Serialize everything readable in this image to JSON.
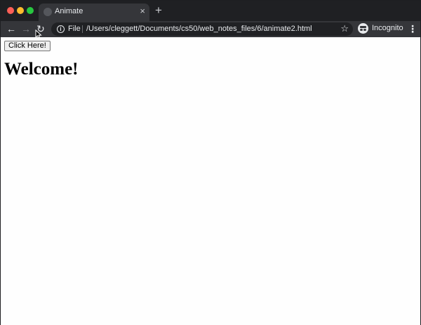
{
  "browser": {
    "tab": {
      "title": "Animate",
      "close_glyph": "×"
    },
    "new_tab_glyph": "+",
    "nav": {
      "back_glyph": "←",
      "forward_glyph": "→",
      "reload_glyph": "↻"
    },
    "omnibox": {
      "scheme": "File",
      "url": "/Users/cleggett/Documents/cs50/web_notes_files/6/animate2.html",
      "star_glyph": "☆"
    },
    "profile": {
      "label": "Incognito"
    },
    "menu_glyph": "⋮"
  },
  "page": {
    "button_label": "Click Here!",
    "heading": "Welcome!"
  },
  "icons": {
    "close": "close-icon",
    "new_tab": "plus-icon",
    "back": "back-arrow-icon",
    "forward": "forward-arrow-icon",
    "reload": "reload-icon",
    "info": "info-icon",
    "star": "star-icon",
    "incognito": "incognito-icon",
    "menu": "kebab-menu-icon",
    "cursor": "mouse-cursor-icon"
  },
  "colors": {
    "tabstrip_bg": "#1f2023",
    "toolbar_bg": "#35363a",
    "omnibox_bg": "#202124",
    "text_light": "#e8eaed",
    "traffic_red": "#fe5f57",
    "traffic_yellow": "#febc2e",
    "traffic_green": "#28c840"
  }
}
